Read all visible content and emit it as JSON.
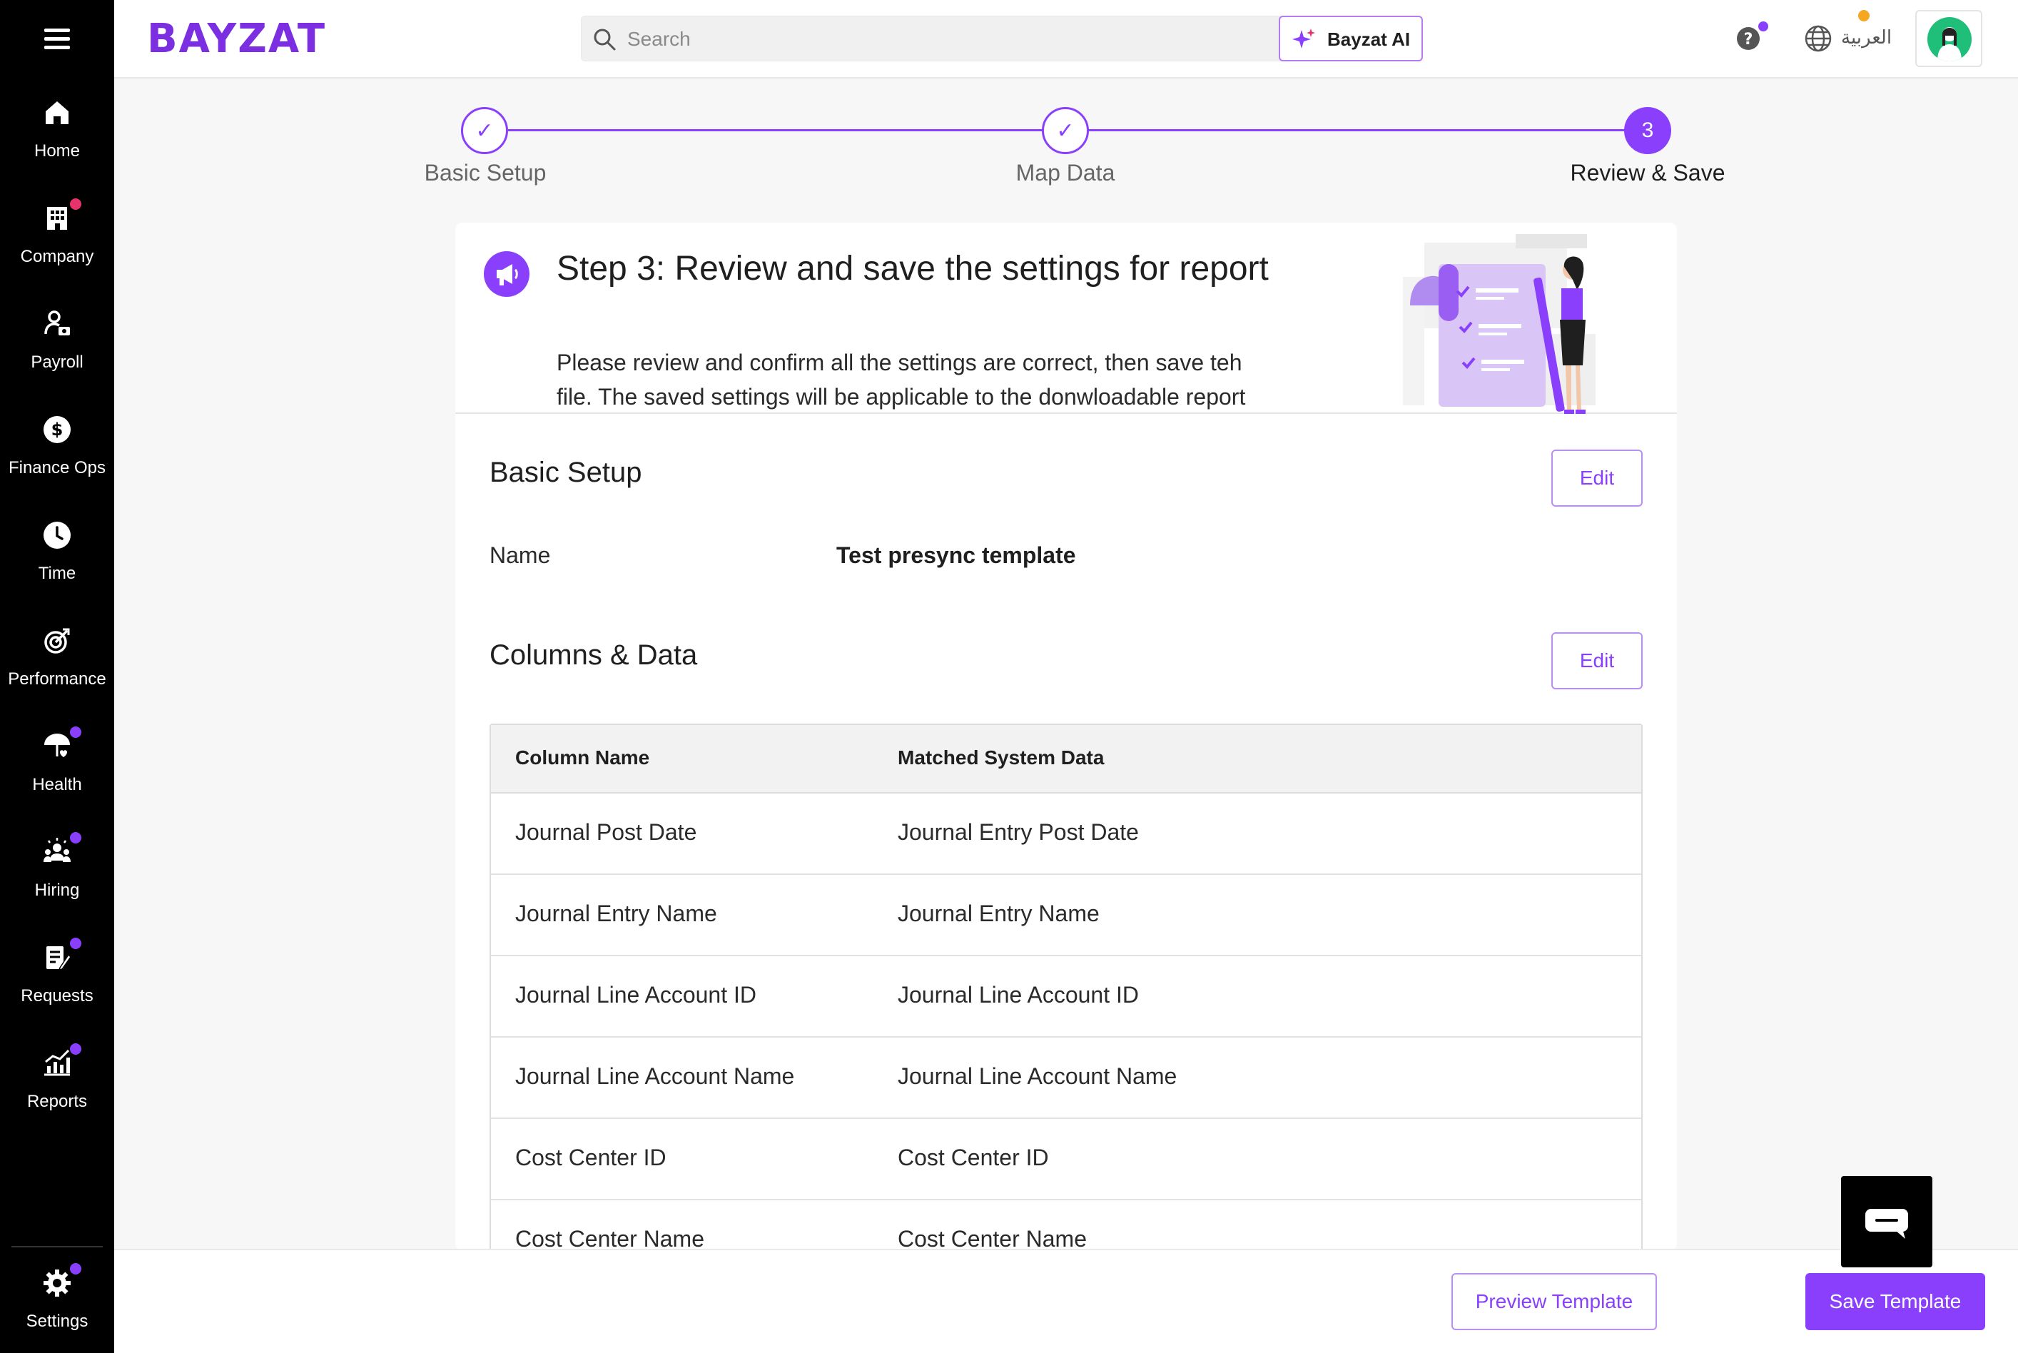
{
  "brand": {
    "logo_text": "BAYZAT",
    "accent": "#8a3ffc"
  },
  "sidebar": {
    "items": [
      {
        "label": "Home",
        "icon": "home-icon",
        "dot": ""
      },
      {
        "label": "Company",
        "icon": "building-icon",
        "dot": "#e6336b"
      },
      {
        "label": "Payroll",
        "icon": "payroll-icon",
        "dot": ""
      },
      {
        "label": "Finance Ops",
        "icon": "dollar-icon",
        "dot": ""
      },
      {
        "label": "Time",
        "icon": "clock-icon",
        "dot": ""
      },
      {
        "label": "Performance",
        "icon": "target-icon",
        "dot": ""
      },
      {
        "label": "Health",
        "icon": "umbrella-heart-icon",
        "dot": "#8a3ffc"
      },
      {
        "label": "Hiring",
        "icon": "people-icon",
        "dot": "#8a3ffc"
      },
      {
        "label": "Requests",
        "icon": "clipboard-icon",
        "dot": "#8a3ffc"
      },
      {
        "label": "Reports",
        "icon": "chart-icon",
        "dot": "#8a3ffc"
      }
    ],
    "settings": {
      "label": "Settings",
      "icon": "gear-icon",
      "dot": "#8a3ffc"
    }
  },
  "header": {
    "search_placeholder": "Search",
    "ai_label": "Bayzat AI",
    "language": "العربية",
    "help_dot": "#8a3ffc",
    "avatar_dot": "#f5a623"
  },
  "stepper": {
    "steps": [
      {
        "label": "Basic Setup",
        "state": "done",
        "marker": "✓"
      },
      {
        "label": "Map Data",
        "state": "done",
        "marker": "✓"
      },
      {
        "label": "Review & Save",
        "state": "active",
        "marker": "3"
      }
    ]
  },
  "intro": {
    "title": "Step 3: Review and save the settings for report",
    "description": "Please review and confirm all the settings are correct, then save teh file. The saved settings will be applicable to the donwloadable report"
  },
  "basic_setup": {
    "title": "Basic Setup",
    "edit_label": "Edit",
    "name_label": "Name",
    "name_value": "Test presync template"
  },
  "columns": {
    "title": "Columns & Data",
    "edit_label": "Edit",
    "headers": [
      "Column Name",
      "Matched System Data"
    ],
    "rows": [
      [
        "Journal Post Date",
        "Journal Entry Post Date"
      ],
      [
        "Journal Entry Name",
        "Journal Entry Name"
      ],
      [
        "Journal Line Account ID",
        "Journal Line Account ID"
      ],
      [
        "Journal Line Account Name",
        "Journal Line Account Name"
      ],
      [
        "Cost Center ID",
        "Cost Center ID"
      ],
      [
        "Cost Center Name",
        "Cost Center Name"
      ]
    ]
  },
  "footer": {
    "preview_label": "Preview Template",
    "save_label": "Save Template"
  }
}
